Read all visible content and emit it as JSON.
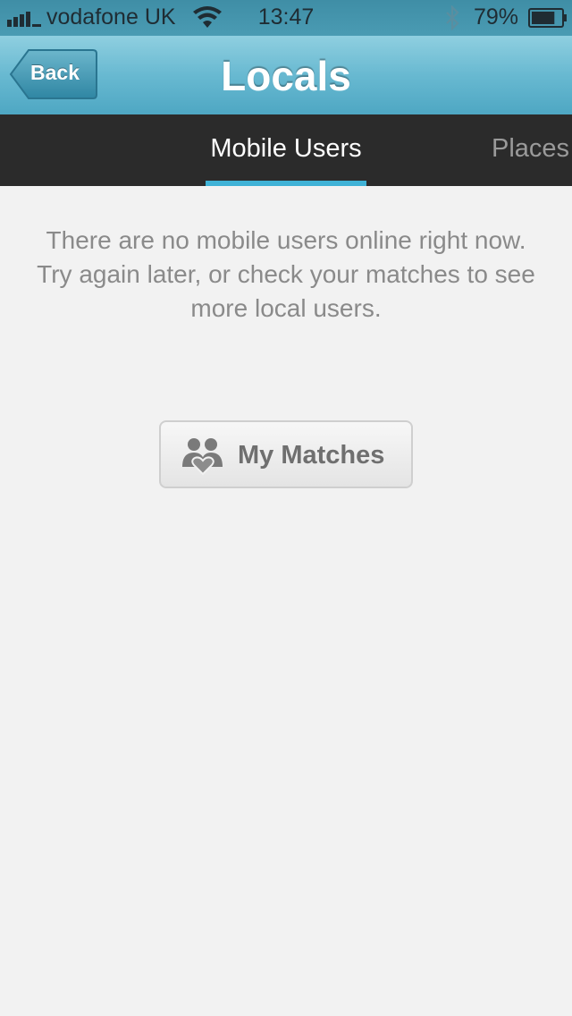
{
  "status_bar": {
    "carrier": "vodafone UK",
    "time": "13:47",
    "battery_percent": "79%",
    "battery_level": 0.79,
    "icons": [
      "signal-icon",
      "wifi-icon",
      "bluetooth-icon",
      "battery-icon"
    ]
  },
  "nav_bar": {
    "back_label": "Back",
    "title": "Locals"
  },
  "tabs": [
    {
      "label": "Mobile Users",
      "active": true
    },
    {
      "label": "Places",
      "active": false
    }
  ],
  "empty_state": {
    "line1": "There are no mobile users online right now.",
    "line2": "Try again later, or check your matches to see more local users."
  },
  "matches_button": {
    "label": "My Matches",
    "icon": "couple-heart-icon"
  },
  "colors": {
    "nav_bar": "#68b9d1",
    "tab_bar": "#2b2b2b",
    "tab_indicator": "#3fb2d6",
    "background": "#f2f2f2"
  }
}
